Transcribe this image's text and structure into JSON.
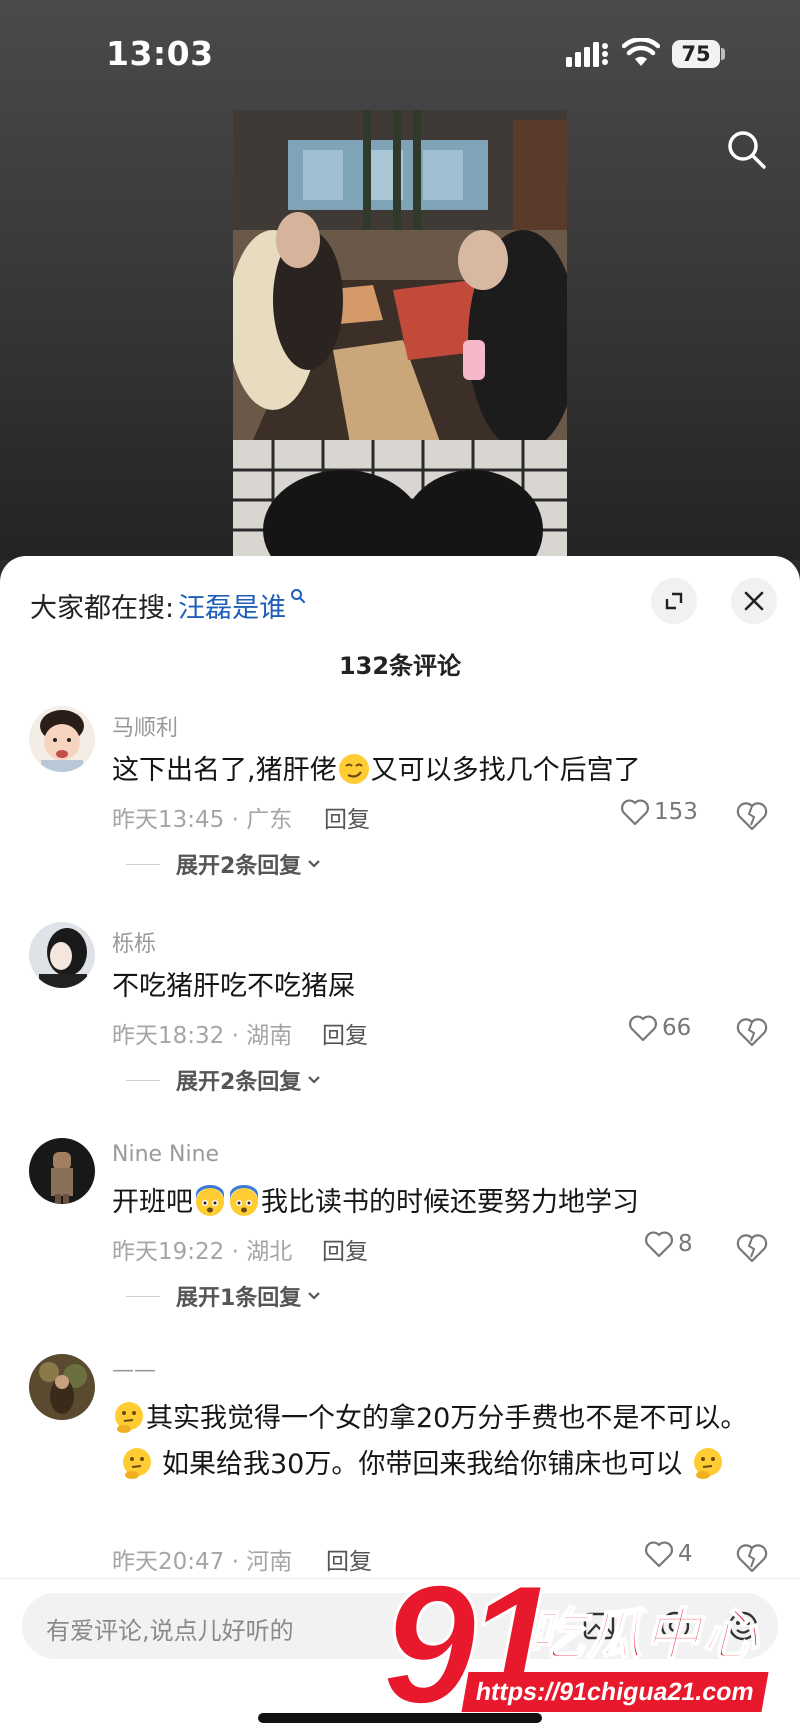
{
  "status_bar": {
    "time": "13:03",
    "battery": "75"
  },
  "trending": {
    "prefix": "大家都在搜:",
    "query": "汪磊是谁"
  },
  "comments_header": {
    "count_label": "132条评论"
  },
  "comments": [
    {
      "username": "马顺利",
      "text_before": "这下出名了,猪肝佬",
      "text_after": "又可以多找几个后宫了",
      "meta": "昨天13:45 · 广东",
      "reply": "回复",
      "likes": "153",
      "expand": "展开2条回复"
    },
    {
      "username": "栎栎",
      "text": "不吃猪肝吃不吃猪屎",
      "meta": "昨天18:32 · 湖南",
      "reply": "回复",
      "likes": "66",
      "expand": "展开2条回复"
    },
    {
      "username": "Nine Nine",
      "text_before": "开班吧",
      "text_after": "我比读书的时候还要努力地学习",
      "meta": "昨天19:22 · 湖北",
      "reply": "回复",
      "likes": "8",
      "expand": "展开1条回复"
    },
    {
      "username": "——",
      "text_a": "其实我觉得一个女的拿20万分手费也不是不可以。",
      "text_b": "如果给我30万。你带回来我给你铺床也可以",
      "meta": "昨天20:47 · 河南",
      "reply": "回复",
      "likes": "4"
    }
  ],
  "input": {
    "placeholder": "有爱评论,说点儿好听的"
  },
  "watermark": {
    "number": "91",
    "text": "吃瓜中心",
    "url": "https://91chigua21.com"
  },
  "colors": {
    "accent_link": "#1f5fb8",
    "watermark_red": "#e8192c"
  }
}
